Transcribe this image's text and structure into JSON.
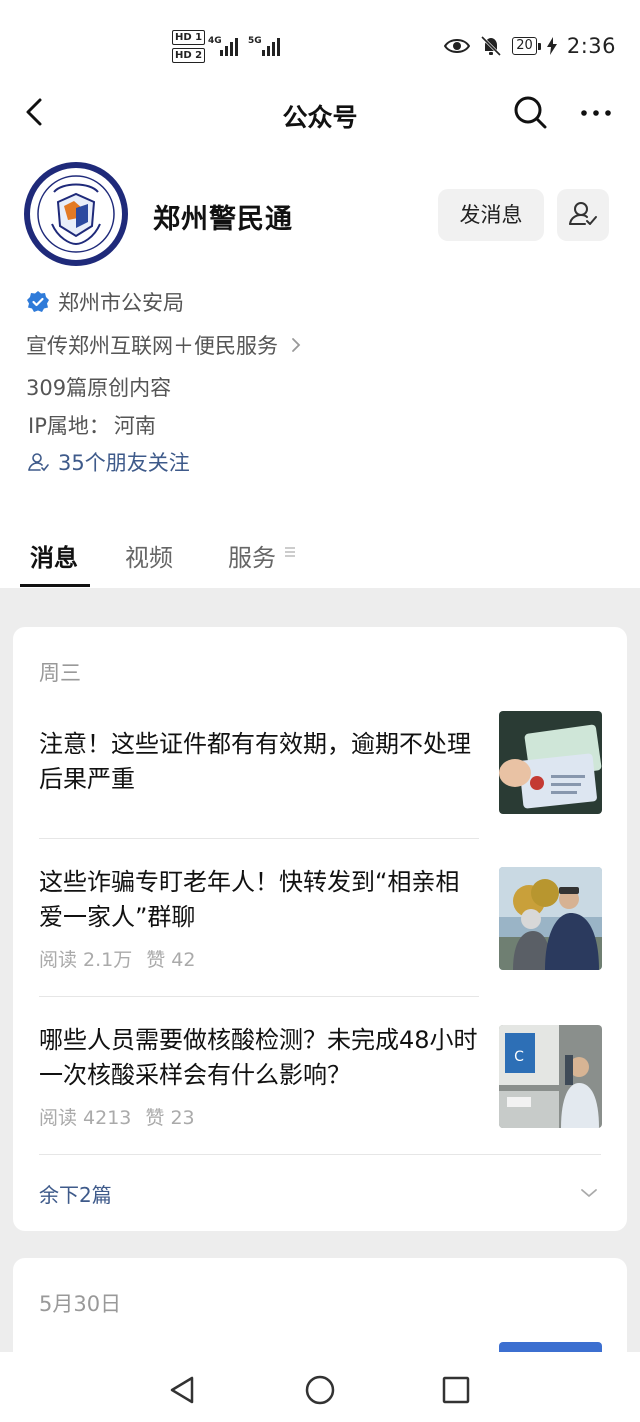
{
  "status_bar": {
    "sim1": "HD 1",
    "sim2": "HD 2",
    "net1": "4G",
    "net2": "5G",
    "battery": "20",
    "time": "2:36"
  },
  "nav": {
    "title": "公众号"
  },
  "profile": {
    "name": "郑州警民通",
    "send_message_label": "发消息",
    "verified_org": "郑州市公安局",
    "description": "宣传郑州互联网＋便民服务",
    "original_count": "309篇原创内容",
    "ip_label": "IP属地：",
    "ip_value": "河南",
    "friends_following": "35个朋友关注"
  },
  "tabs": [
    {
      "label": "消息",
      "active": true
    },
    {
      "label": "视频",
      "active": false
    },
    {
      "label": "服务",
      "active": false
    }
  ],
  "feed": [
    {
      "day": "周三",
      "articles": [
        {
          "title": "注意！这些证件都有有效期，逾期不处理后果严重",
          "reads": "",
          "likes": "",
          "thumb_icon": "id-cards-image"
        },
        {
          "title": "这些诈骗专盯老年人！快转发到“相亲相爱一家人”群聊",
          "reads": "阅读 2.1万",
          "likes": "赞 42",
          "thumb_icon": "elderly-couple-image"
        },
        {
          "title": "哪些人员需要做核酸检测？未完成48小时一次核酸采样会有什么影响？",
          "reads": "阅读 4213",
          "likes": "赞 23",
          "thumb_icon": "nucleic-test-image"
        }
      ],
      "more_label": "余下2篇"
    },
    {
      "day": "5月30日"
    }
  ],
  "colors": {
    "link_blue": "#3e5a8a",
    "verified_blue": "#2f7bd9",
    "logo_navy": "#1f2a7a"
  }
}
